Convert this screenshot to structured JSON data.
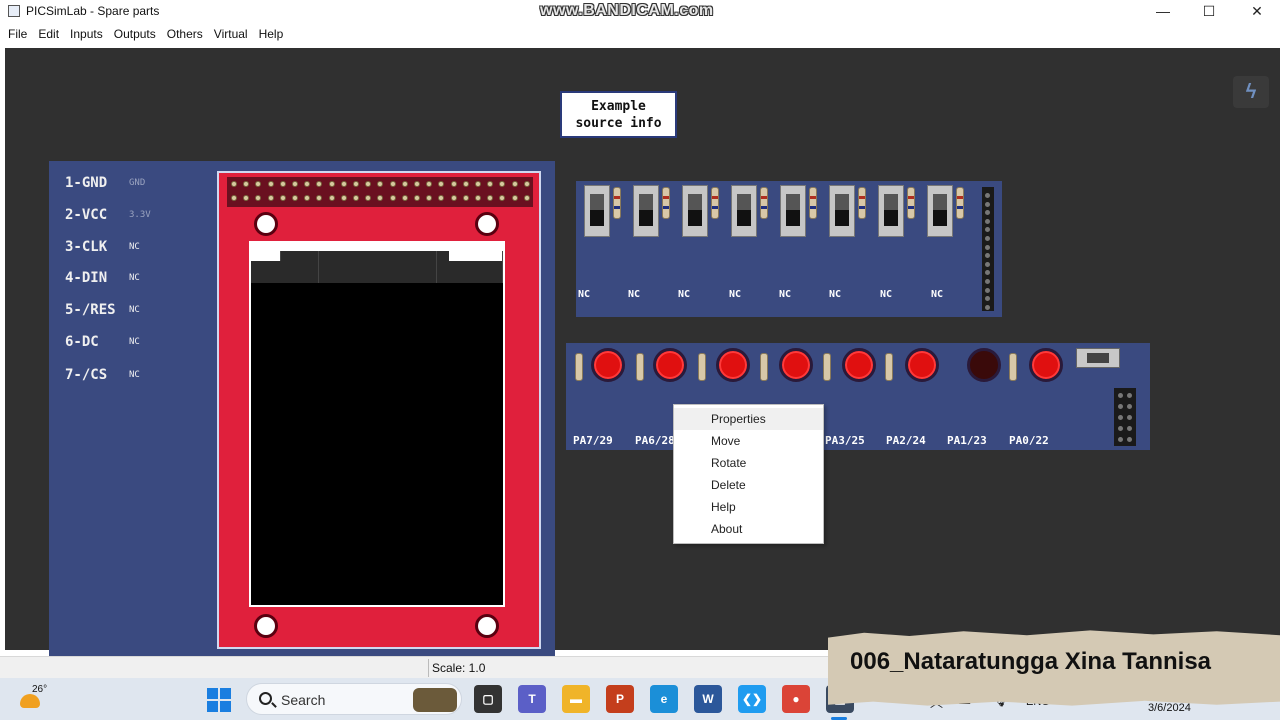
{
  "window": {
    "title": "PICSimLab - Spare parts",
    "watermark": "www.BANDICAM.com",
    "minimize": "—",
    "maximize": "☐",
    "close": "✕"
  },
  "menu": [
    "File",
    "Edit",
    "Inputs",
    "Outputs",
    "Others",
    "Virtual",
    "Help"
  ],
  "lcd": {
    "pins": [
      {
        "name": "1-GND",
        "value": "GND"
      },
      {
        "name": "2-VCC",
        "value": "3.3V"
      },
      {
        "name": "3-CLK",
        "value": "NC"
      },
      {
        "name": "4-DIN",
        "value": "NC"
      },
      {
        "name": "5-/RES",
        "value": "NC"
      },
      {
        "name": "6-DC",
        "value": "NC"
      },
      {
        "name": "7-/CS",
        "value": "NC"
      }
    ]
  },
  "example_box": {
    "text": "Example\nsource info"
  },
  "switches": {
    "labels": [
      "NC",
      "NC",
      "NC",
      "NC",
      "NC",
      "NC",
      "NC",
      "NC"
    ]
  },
  "leds": {
    "labels": [
      "PA7/29",
      "PA6/28",
      "PA3/25",
      "PA2/24",
      "PA1/23",
      "PA0/22"
    ],
    "states": [
      true,
      true,
      true,
      true,
      true,
      true,
      false,
      true
    ]
  },
  "context_menu": {
    "items": [
      "Properties",
      "Move",
      "Rotate",
      "Delete",
      "Help",
      "About"
    ],
    "highlighted": "Properties"
  },
  "statusbar": {
    "scale": "Scale: 1.0"
  },
  "taskbar": {
    "temperature": "26°",
    "search_placeholder": "Search",
    "language": "ENG",
    "date": "3/6/2024",
    "apps": [
      {
        "icon": "task-view-icon",
        "color": "#333333",
        "glyph": "▢"
      },
      {
        "icon": "teams-icon",
        "color": "#5b5fc7",
        "glyph": "T"
      },
      {
        "icon": "file-explorer-icon",
        "color": "#f0b429",
        "glyph": "▬"
      },
      {
        "icon": "powerpoint-icon",
        "color": "#c43e1c",
        "glyph": "P"
      },
      {
        "icon": "edge-icon",
        "color": "#1b8fd8",
        "glyph": "e"
      },
      {
        "icon": "word-icon",
        "color": "#2b579a",
        "glyph": "W"
      },
      {
        "icon": "vscode-icon",
        "color": "#1f9cf0",
        "glyph": "❮❯"
      },
      {
        "icon": "chrome-icon",
        "color": "#db4437",
        "glyph": "●"
      },
      {
        "icon": "picsimlab-icon",
        "color": "#3a4a60",
        "glyph": "▦"
      }
    ]
  },
  "overlay": {
    "name": "006_Nataratungga Xina Tannisa"
  }
}
